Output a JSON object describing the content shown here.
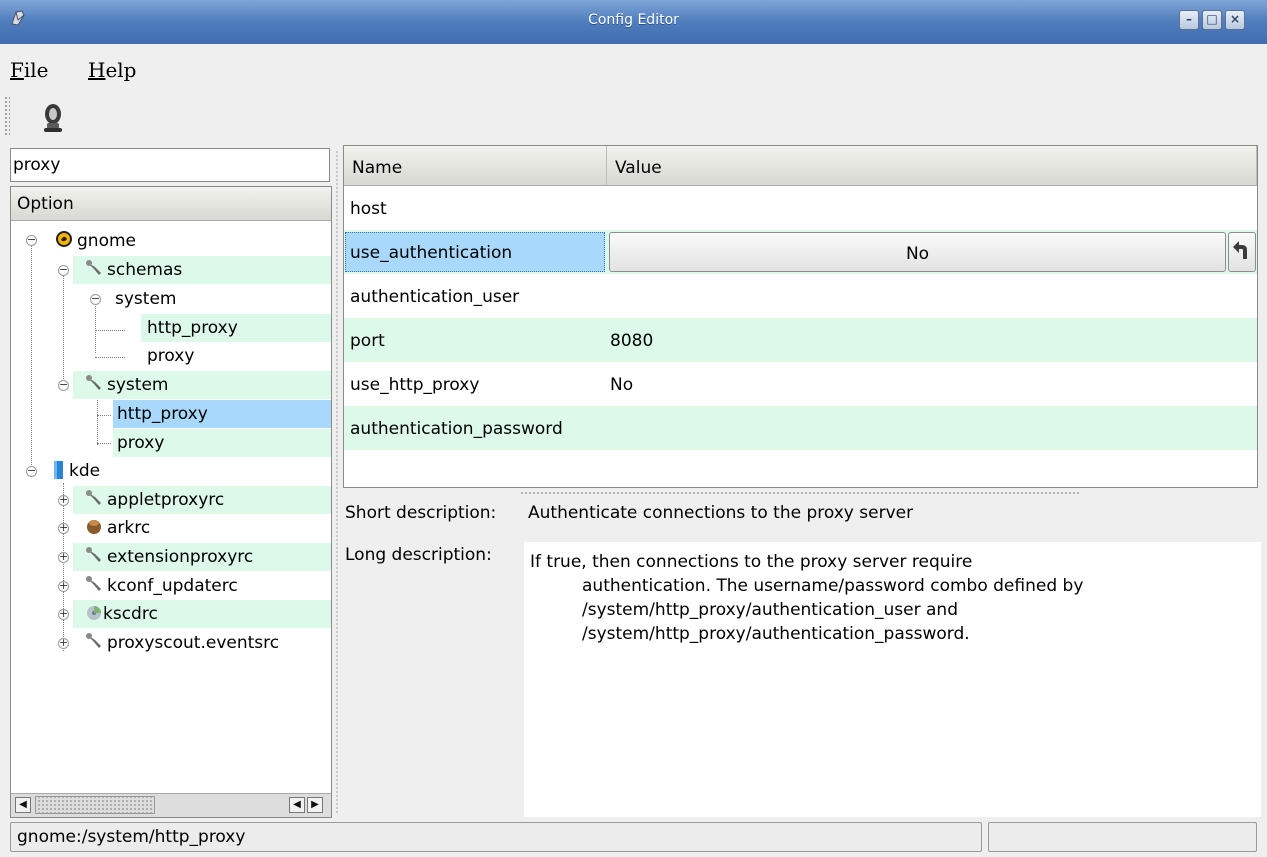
{
  "window": {
    "title": "Config Editor"
  },
  "menu": [
    {
      "label": "File",
      "mnemonic": "F",
      "rest": "ile"
    },
    {
      "label": "Help",
      "mnemonic": "H",
      "rest": "elp"
    }
  ],
  "search": {
    "value": "proxy"
  },
  "tree": {
    "header": "Option",
    "nodes": {
      "gnome": "gnome",
      "gnome_schemas": "schemas",
      "gnome_schemas_system": "system",
      "gnome_schemas_system_http_proxy": "http_proxy",
      "gnome_schemas_system_proxy": "proxy",
      "gnome_system": "system",
      "gnome_system_http_proxy": "http_proxy",
      "gnome_system_proxy": "proxy",
      "kde": "kde",
      "kde_appletproxyrc": "appletproxyrc",
      "kde_arkrc": "arkrc",
      "kde_extensionproxyrc": "extensionproxyrc",
      "kde_kconf_updaterc": "kconf_updaterc",
      "kde_kscdrc": "kscdrc",
      "kde_proxyscout": "proxyscout.eventsrc"
    }
  },
  "table": {
    "columns": {
      "name": "Name",
      "value": "Value"
    },
    "rows": [
      {
        "name": "host",
        "value": ""
      },
      {
        "name": "use_authentication",
        "value": "No"
      },
      {
        "name": "authentication_user",
        "value": ""
      },
      {
        "name": "port",
        "value": "8080"
      },
      {
        "name": "use_http_proxy",
        "value": "No"
      },
      {
        "name": "authentication_password",
        "value": ""
      }
    ]
  },
  "description": {
    "short_label": "Short description:",
    "short_value": "Authenticate connections to the proxy server",
    "long_label": "Long description:",
    "long_lines": [
      "If true, then connections to the proxy server require",
      "authentication.  The username/password combo defined by",
      "/system/http_proxy/authentication_user and",
      "/system/http_proxy/authentication_password."
    ]
  },
  "status": {
    "path": "gnome:/system/http_proxy",
    "secondary": ""
  },
  "colors": {
    "alt_row": "#dcf9ea",
    "selection": "#a8d8fb",
    "titlebar": "#4e7cbd"
  }
}
